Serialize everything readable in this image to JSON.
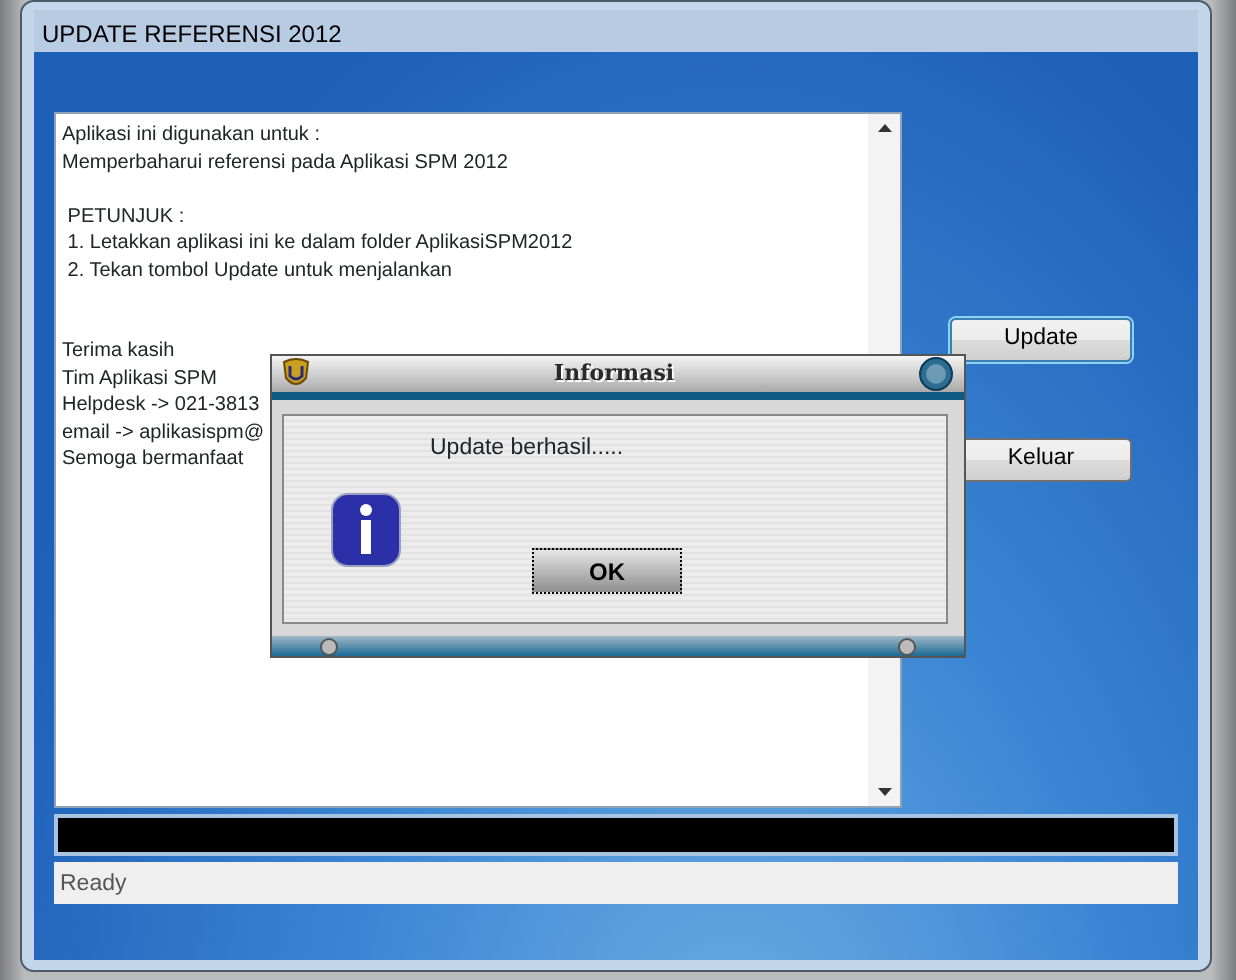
{
  "window": {
    "title": "UPDATE REFERENSI 2012"
  },
  "info_text": {
    "blocks": [
      [
        "Aplikasi ini digunakan untuk :",
        "Memperbaharui referensi pada Aplikasi SPM 2012"
      ],
      [
        " PETUNJUK :",
        " 1. Letakkan aplikasi ini ke dalam folder AplikasiSPM2012",
        " 2. Tekan tombol Update untuk menjalankan"
      ],
      [
        "Terima kasih",
        "Tim Aplikasi SPM",
        "Helpdesk -> 021-3813",
        "email -> aplikasispm@",
        "Semoga bermanfaat"
      ]
    ]
  },
  "buttons": [
    {
      "label": "Update",
      "focused": true
    },
    {
      "label": "Keluar",
      "focused": false
    }
  ],
  "status_bar": {
    "text": "Ready"
  },
  "dialog": {
    "title": "Informasi",
    "message": "Update berhasil.....",
    "button": "OK"
  }
}
